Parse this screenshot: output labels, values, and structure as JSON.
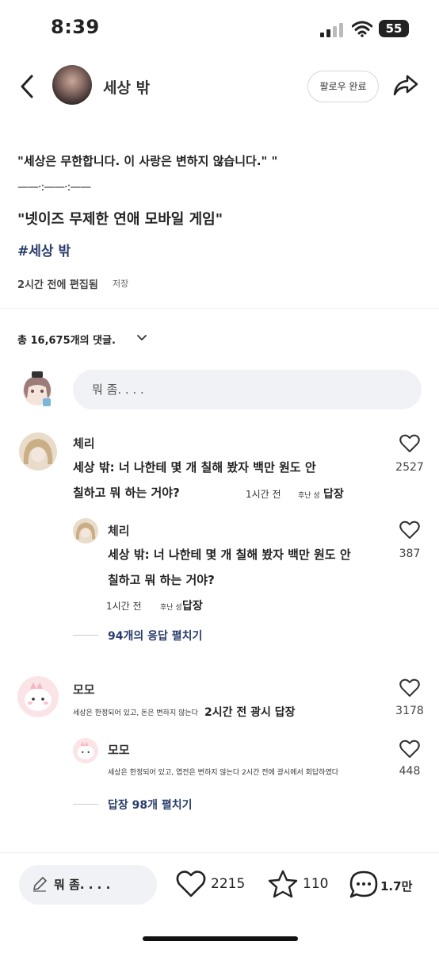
{
  "status_bar": {
    "time": "8:39",
    "battery": "55"
  },
  "header": {
    "author_name": "세상 밖",
    "follow_label": "팔로우 완료"
  },
  "post": {
    "quote": "\"세상은 무한합니다. 이 사랑은 변하지 않습니다.\" \"",
    "divider": "——·:——·:——",
    "title": "\"넷이즈 무제한 연애 모바일 게임\"",
    "hashtag": "#세상 밖",
    "edit_time": "2시간 전에 편집됨",
    "save_label": "저장"
  },
  "comments_header": {
    "count_label": "총 16,675개의 댓글."
  },
  "comment_input": {
    "placeholder": "뭐 좀. . . ."
  },
  "comments": [
    {
      "name": "체리",
      "text_line1": "세상 밖: 너 나한테 몇 개 칠해 봤자 백만 원도 안",
      "text_line2": "칠하고 뭐 하는 거야?",
      "time": "1시간 전",
      "source": "후난 성",
      "reply_label": "답장",
      "likes": "2527",
      "reply": {
        "name": "체리",
        "text_line1": "세상 밖: 너 나한테 몇 개 칠해 봤자 백만 원도 안",
        "text_line2": "칠하고 뭐 하는 거야?",
        "time": "1시간 전",
        "source": "후난 성",
        "reply_label": "답장",
        "likes": "387"
      },
      "expand_label": "94개의 응답 펼치기"
    },
    {
      "name": "모모",
      "text": "세상은 한정되어 있고, 돈은 변하지 않는다",
      "time_reply": "2시간 전 광시 답장",
      "likes": "3178",
      "reply": {
        "name": "모모",
        "text": "세상은 한정되어 있고, 엽전은 변하지 않는다 2시간 전에 광시에서 회답하였다",
        "likes": "448"
      },
      "expand_label": "답장 98개 펼치기"
    }
  ],
  "bottom_bar": {
    "input_label": "뭐 좀. . . .",
    "likes": "2215",
    "favorites": "110",
    "comments": "1.7만"
  },
  "colors": {
    "accent": "#2a3d6b",
    "pill_bg": "#f1f2f6"
  },
  "icons": [
    "back-arrow-icon",
    "share-icon",
    "chevron-down-icon",
    "heart-icon",
    "star-icon",
    "comment-bubble-icon",
    "pencil-icon",
    "signal-icon",
    "wifi-icon",
    "battery-icon"
  ]
}
